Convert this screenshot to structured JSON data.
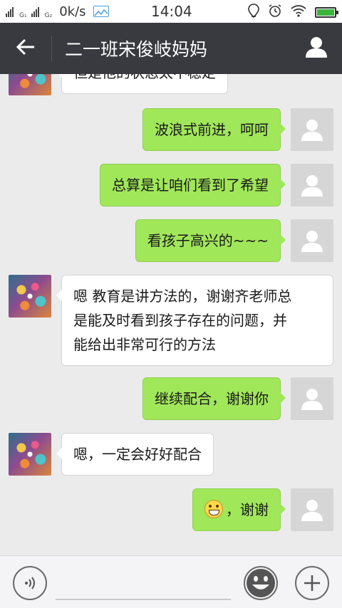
{
  "status_bar": {
    "sim1_tag": "G₁",
    "sim2_tag": "G₂",
    "net_speed": "0k/s",
    "time": "14:04"
  },
  "title_bar": {
    "title": "二一班宋俊岐妈妈"
  },
  "messages": [
    {
      "from": "other",
      "text": "但是他的状态太不稳定"
    },
    {
      "from": "self",
      "text": "波浪式前进，呵呵"
    },
    {
      "from": "self",
      "text": "总算是让咱们看到了希望"
    },
    {
      "from": "self",
      "text": "看孩子高兴的~~~"
    },
    {
      "from": "other",
      "lines": [
        "嗯 教育是讲方法的，谢谢齐老师总",
        "是能及时看到孩子存在的问题，并",
        "能给出非常可行的方法"
      ]
    },
    {
      "from": "self",
      "text": "继续配合，谢谢你"
    },
    {
      "from": "other",
      "text": "嗯，一定会好好配合"
    },
    {
      "from": "self",
      "emoji": "grin",
      "text": "，谢谢"
    }
  ],
  "input_bar": {
    "placeholder": ""
  },
  "colors": {
    "title_bar_bg": "#393a3f",
    "chat_bg": "#ebebeb",
    "self_bubble": "#a0e75a",
    "other_bubble": "#ffffff"
  },
  "icons": [
    "back-arrow-icon",
    "profile-icon",
    "voice-icon",
    "emoji-icon",
    "plus-icon",
    "wifi-icon",
    "alarm-icon",
    "location-icon"
  ]
}
